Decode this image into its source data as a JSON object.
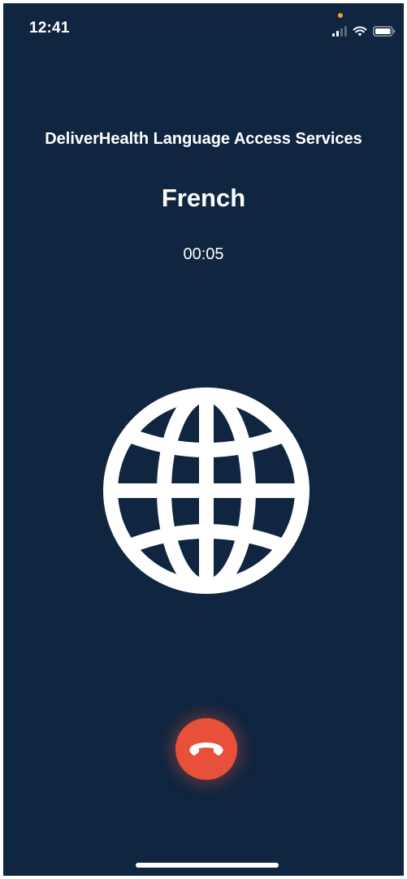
{
  "status_bar": {
    "time": "12:41",
    "icons": [
      "cellular-signal-icon",
      "wifi-icon",
      "battery-icon"
    ],
    "mic_indicator_color": "#f0a030"
  },
  "call": {
    "organization": "DeliverHealth Language Access Services",
    "language": "French",
    "duration": "00:05",
    "center_icon": "globe-icon",
    "end_call_icon": "phone-hangup-icon"
  },
  "colors": {
    "background": "#0f2540",
    "text": "#ffffff",
    "end_call": "#e8503a"
  }
}
